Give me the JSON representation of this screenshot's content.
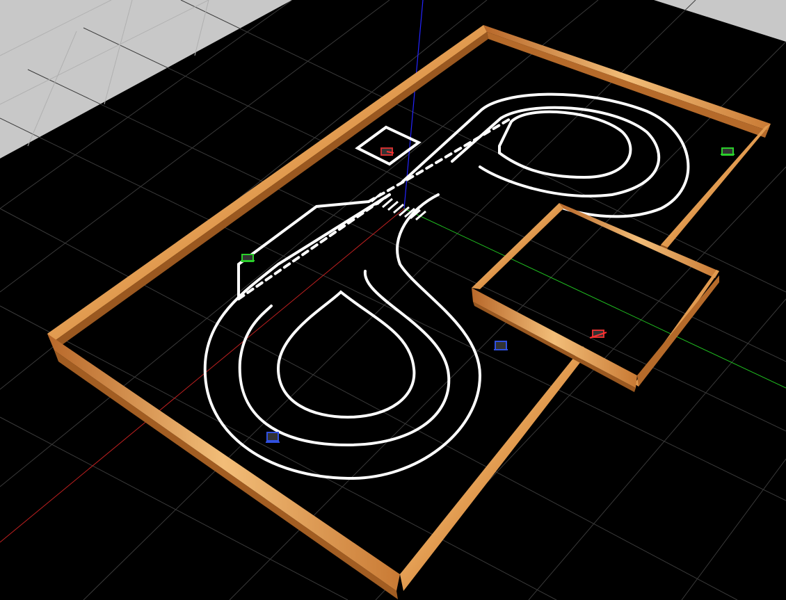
{
  "scene": {
    "type": "3d-simulation-viewport",
    "colors": {
      "background": "#000000",
      "far_plane": "#c8c8c8",
      "grid": "#3c3c3c",
      "track_lines": "#ffffff",
      "wall_wood": "#d98a3d",
      "axis_x": "#ff2020",
      "axis_y": "#20ff20",
      "axis_z": "#2020ff"
    },
    "objects": [
      {
        "name": "outer-wooden-wall",
        "material": "wood"
      },
      {
        "name": "inner-wooden-enclosure",
        "material": "wood"
      },
      {
        "name": "white-track-lines"
      },
      {
        "name": "crosswalk-stripes"
      },
      {
        "name": "parking-box"
      },
      {
        "name": "coordinate-axes"
      }
    ],
    "robots": [
      {
        "name": "robot-red-parking",
        "color": "#d03030"
      },
      {
        "name": "robot-green-right",
        "color": "#2bd02b"
      },
      {
        "name": "robot-green-left",
        "color": "#2bd02b"
      },
      {
        "name": "robot-red-enclosure",
        "color": "#e03030"
      },
      {
        "name": "robot-blue-center",
        "color": "#3050e0"
      },
      {
        "name": "robot-blue-bottom",
        "color": "#3050e0"
      }
    ]
  }
}
